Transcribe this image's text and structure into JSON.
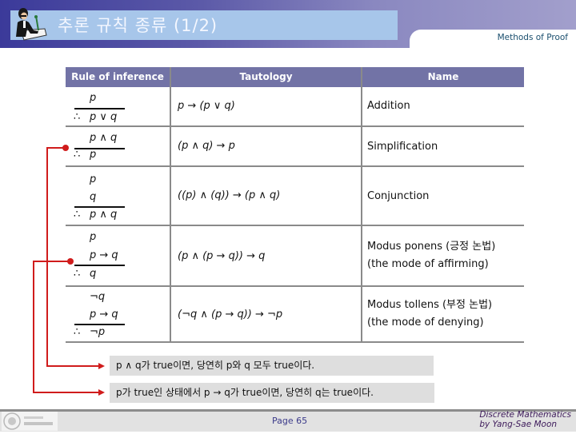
{
  "header": {
    "title": "추론 규칙 종류 (1/2)",
    "section": "Methods of Proof",
    "logo_icon": "person-writing-icon"
  },
  "table": {
    "columns": [
      "Rule of inference",
      "Tautology",
      "Name"
    ],
    "rows": [
      {
        "premises": [
          "p"
        ],
        "therefore": "∴",
        "conclusion": "p ∨ q",
        "tautology": "p → (p ∨ q)",
        "name": [
          "Addition"
        ]
      },
      {
        "premises": [
          "p ∧ q"
        ],
        "therefore": "∴",
        "conclusion": "p",
        "tautology": "(p ∧ q) → p",
        "name": [
          "Simplification"
        ]
      },
      {
        "premises": [
          "p",
          "q"
        ],
        "therefore": "∴",
        "conclusion": "p ∧ q",
        "tautology": "((p) ∧ (q)) → (p ∧ q)",
        "name": [
          "Conjunction"
        ]
      },
      {
        "premises": [
          "p",
          "p → q"
        ],
        "therefore": "∴",
        "conclusion": "q",
        "tautology": "(p ∧ (p → q)) → q",
        "name": [
          "Modus ponens (긍정 논법)",
          "(the mode of affirming)"
        ]
      },
      {
        "premises": [
          "¬q",
          "p → q"
        ],
        "therefore": "∴",
        "conclusion": "¬p",
        "tautology": "(¬q ∧ (p → q)) → ¬p",
        "name": [
          "Modus tollens (부정 논법)",
          "(the mode of denying)"
        ]
      }
    ]
  },
  "notes": [
    "p ∧ q가 true이면, 당연히 p와 q 모두 true이다.",
    "p가 true인 상태에서 p → q가 true이면, 당연히 q는 true이다."
  ],
  "connector_color": "#d01c1c",
  "footer": {
    "page": "Page 65",
    "credit_line1": "Discrete Mathematics",
    "credit_line2": "by Yang-Sae Moon",
    "university_logo": "university-seal-logo"
  }
}
